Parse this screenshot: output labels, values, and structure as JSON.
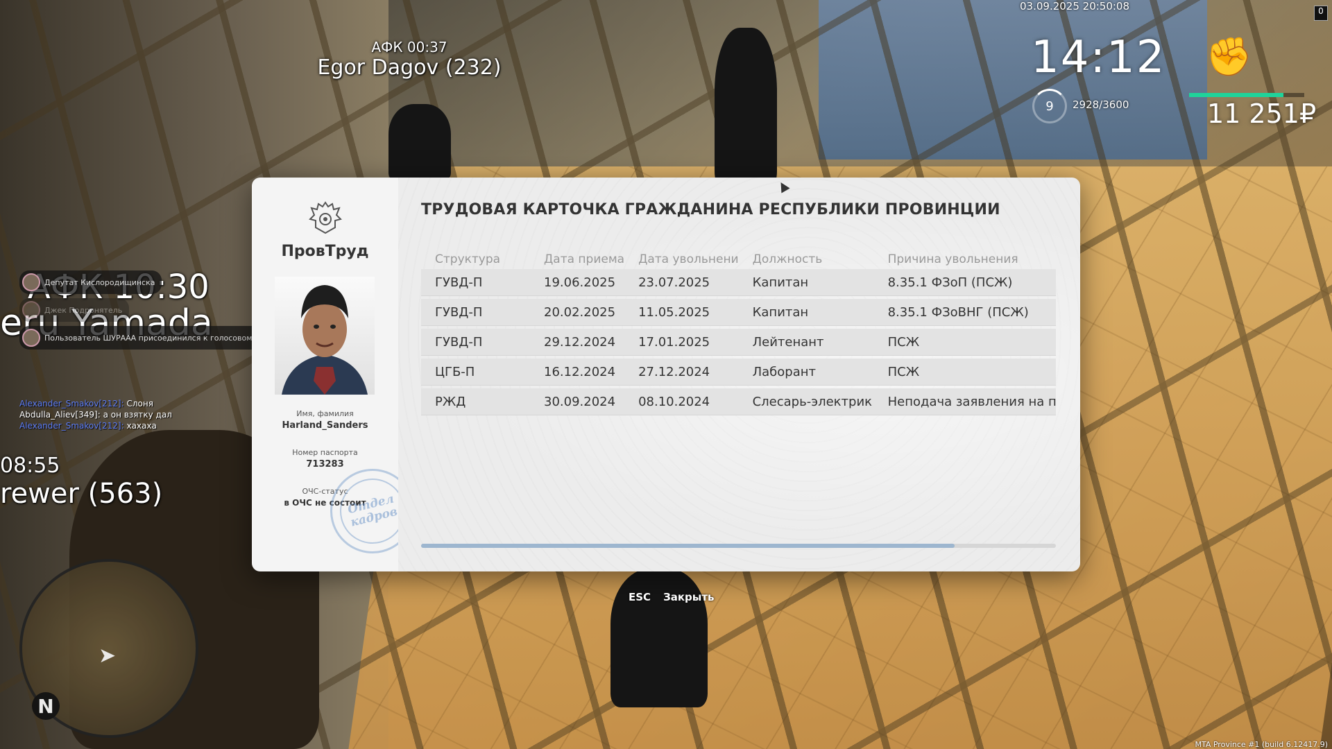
{
  "hud": {
    "datetime": "03.09.2025 20:50:08",
    "clock": "14:12",
    "level": "9",
    "xp": "2928/3600",
    "money": "11 251₽",
    "health_fraction": 0.82,
    "top_right_badge": "0"
  },
  "world": {
    "nametags": [
      {
        "afk": "АФК 00:37",
        "name": "Egor Dagov (232)"
      },
      {
        "afk": "АФК 10:30",
        "name": "eru Yamada"
      },
      {
        "afk": "08:55",
        "name": "rewer (563)"
      }
    ]
  },
  "notifications": [
    {
      "text": "Депутат Кислородищинска"
    },
    {
      "text": "Джек Подронятель"
    },
    {
      "text": "Пользователь ШУРААА присоединился к голосовому чату 👏"
    }
  ],
  "chat": [
    {
      "name": "Alexander_Smakov[212]:",
      "text": " Слоня"
    },
    {
      "name": "Abdulla_Aliev[349]:",
      "text": " а он взятку дал"
    },
    {
      "name": "Alexander_Smakov[212]:",
      "text": " хахаха"
    }
  ],
  "minimap": {
    "north": "N"
  },
  "card": {
    "org": "ПровТруд",
    "title": "ТРУДОВАЯ КАРТОЧКА ГРАЖДАНИНА РЕСПУБЛИКИ ПРОВИНЦИИ",
    "name_label": "Имя, фамилия",
    "name": "Harland_Sanders",
    "passport_label": "Номер паспорта",
    "passport": "713283",
    "status_label": "ОЧС-статус",
    "status": "в ОЧС не состоит",
    "stamp_line1": "Отдел",
    "stamp_line2": "кадров",
    "columns": [
      "Структура",
      "Дата приема",
      "Дата увольнени",
      "Должность",
      "Причина увольнения"
    ],
    "rows": [
      [
        "ГУВД-П",
        "19.06.2025",
        "23.07.2025",
        "Капитан",
        "8.35.1 ФЗоП (ПСЖ)"
      ],
      [
        "ГУВД-П",
        "20.02.2025",
        "11.05.2025",
        "Капитан",
        "8.35.1 ФЗоВНГ (ПСЖ)"
      ],
      [
        "ГУВД-П",
        "29.12.2024",
        "17.01.2025",
        "Лейтенант",
        "ПСЖ"
      ],
      [
        "ЦГБ-П",
        "16.12.2024",
        "27.12.2024",
        "Лаборант",
        "ПСЖ"
      ],
      [
        "РЖД",
        "30.09.2024",
        "08.10.2024",
        "Слесарь-электрик",
        "Неподача заявления на повы"
      ]
    ],
    "scroll_fraction": 0.84
  },
  "footer": {
    "key": "ESC",
    "action": "Закрыть"
  },
  "build": "MTA Province #1 (build 6.12417.9)"
}
